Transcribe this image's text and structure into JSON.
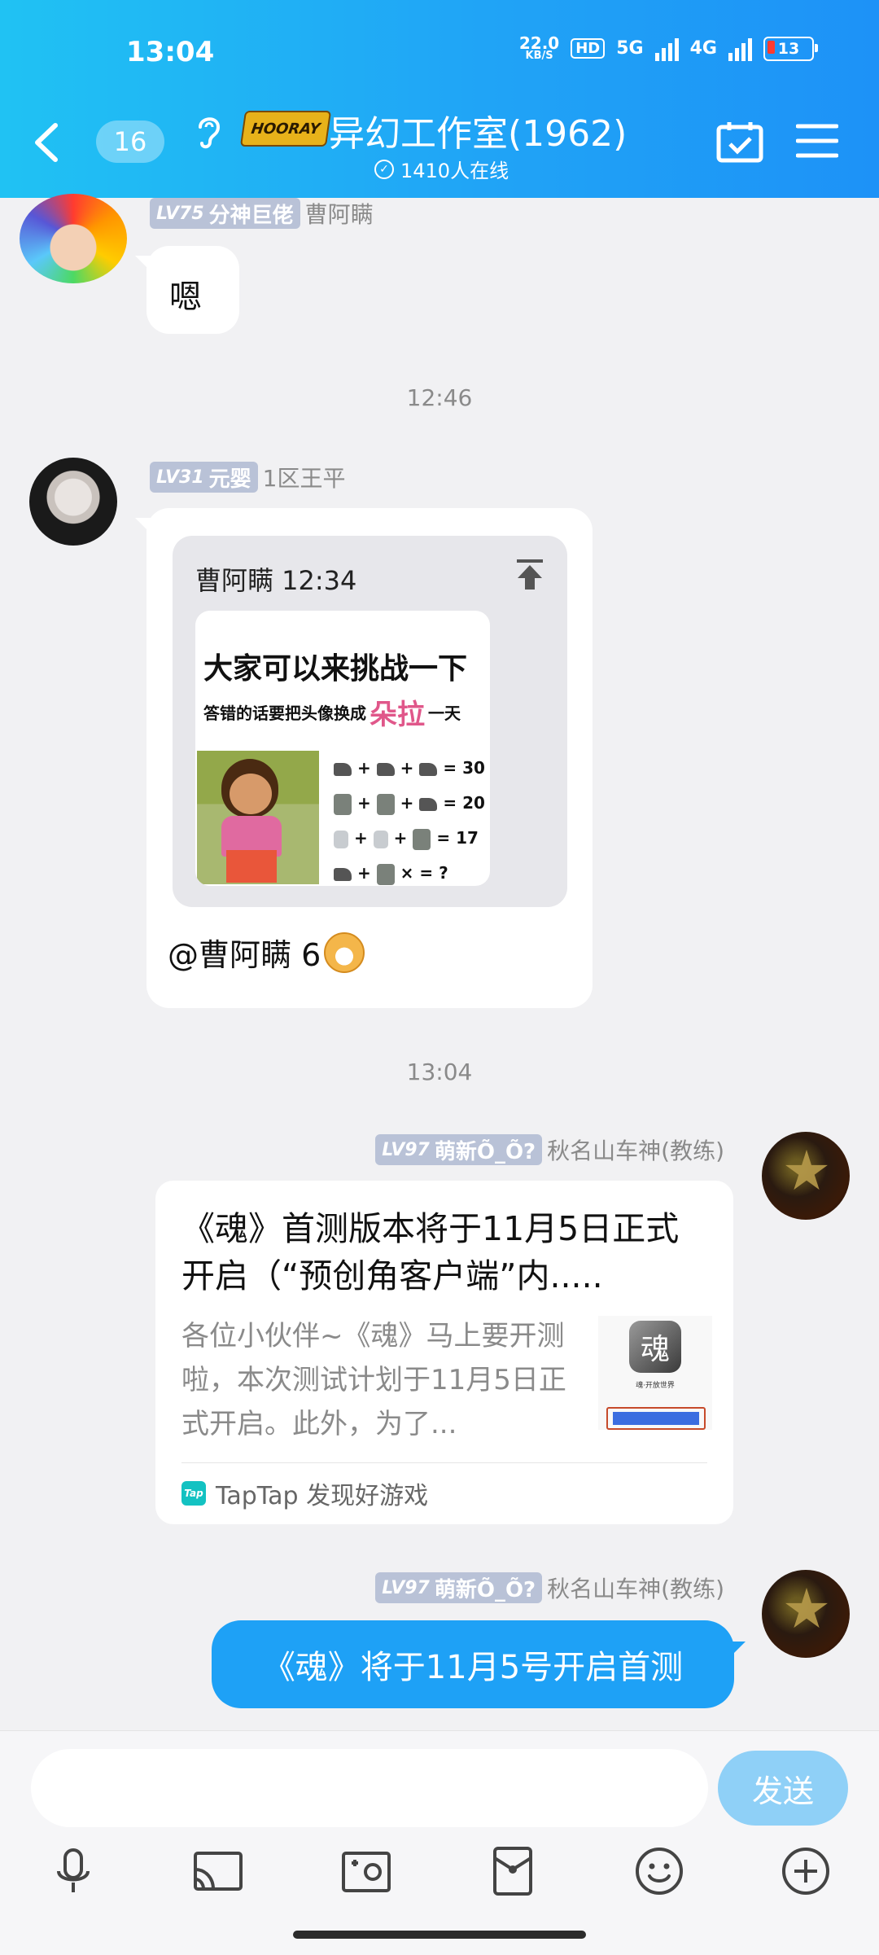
{
  "status_bar": {
    "time": "13:04",
    "speed_value": "22.0",
    "speed_unit": "KB/S",
    "hd": "HD",
    "net1": "5G",
    "net2": "4G",
    "battery": "13"
  },
  "header": {
    "unread_count": "16",
    "badge_text": "HOORAY",
    "title": "异幻工作室(1962)",
    "online": "1410人在线"
  },
  "messages": [
    {
      "level": "LV75",
      "title": "分神巨佬",
      "nick": "曹阿瞒",
      "text": "嗯"
    },
    {
      "level": "LV31",
      "title": "元婴",
      "nick": "1区王平",
      "quote": {
        "header": "曹阿瞒 12:34",
        "meme_title": "大家可以来挑战一下",
        "meme_sub_a": "答错的话要把头像换成",
        "meme_sub_b": "朵拉",
        "meme_sub_c": "一天",
        "rows": [
          "= 30",
          "= 20",
          "= 17",
          "× = ?"
        ]
      },
      "text": "@曹阿瞒 6"
    },
    {
      "level": "LV97",
      "title": "萌新Õ_Õ?",
      "nick": "秋名山车神(教练)",
      "card": {
        "title": "《魂》首测版本将于11月5日正式开启（“预创角客户端”内.....",
        "desc": "各位小伙伴~《魂》马上要开测啦，本次测试计划于11月5日正式开启。此外，为了...",
        "thumb_char": "魂",
        "thumb_label": "魂·开放世界",
        "source": "TapTap 发现好游戏"
      }
    },
    {
      "level": "LV97",
      "title": "萌新Õ_Õ?",
      "nick": "秋名山车神(教练)",
      "text": "《魂》将于11月5号开启首测"
    }
  ],
  "timestamps": [
    "12:46",
    "13:04"
  ],
  "composer": {
    "placeholder": "",
    "send_label": "发送"
  },
  "toolbar_icons": [
    "microphone-icon",
    "cast-icon",
    "photo-icon",
    "red-packet-icon",
    "emoji-icon",
    "plus-icon"
  ]
}
